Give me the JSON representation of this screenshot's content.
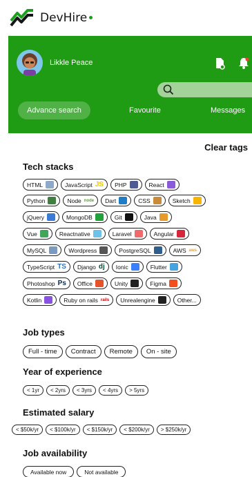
{
  "brand": {
    "name": "DevHire"
  },
  "header": {
    "user_name": "Likkle Peace",
    "tabs": [
      "Advance search",
      "Favourite",
      "Messages"
    ]
  },
  "clear_tags": "Clear tags",
  "tech": {
    "title": "Tech stacks",
    "rows": [
      [
        {
          "label": "HTML",
          "icon": "html-file-icon",
          "color": "#8fa9c8"
        },
        {
          "label": "JavaScript",
          "icon": "js-logo-icon",
          "color": "#f5c400",
          "glyph": "JS"
        },
        {
          "label": "PHP",
          "icon": "php-logo-icon",
          "color": "#4e5b93"
        },
        {
          "label": "React",
          "icon": "react-logo-icon",
          "color": "#8a5bd8"
        }
      ],
      [
        {
          "label": "Python",
          "icon": "python-logo-icon",
          "color": "#3f7f3f"
        },
        {
          "label": "Node",
          "icon": "node-logo-icon",
          "color": "#5a9e3a",
          "glyph": "node"
        },
        {
          "label": "Dart",
          "icon": "dart-logo-icon",
          "color": "#1f7dc6"
        },
        {
          "label": "CSS",
          "icon": "css-brush-icon",
          "color": "#c98a3a"
        },
        {
          "label": "Sketch",
          "icon": "sketch-logo-icon",
          "color": "#f7b500"
        }
      ],
      [
        {
          "label": "jQuery",
          "icon": "jquery-logo-icon",
          "color": "#3a7bd5"
        },
        {
          "label": "MongoDB",
          "icon": "mongodb-leaf-icon",
          "color": "#21a33a"
        },
        {
          "label": "Git",
          "icon": "github-logo-icon",
          "color": "#111111"
        },
        {
          "label": "Java",
          "icon": "java-cup-icon",
          "color": "#e69a2a"
        }
      ],
      [
        {
          "label": "Vue",
          "icon": "vue-logo-icon",
          "color": "#3fa65a"
        },
        {
          "label": "Reactnative",
          "icon": "react-native-logo-icon",
          "color": "#6cc2e8"
        },
        {
          "label": "Laravel",
          "icon": "laravel-logo-icon",
          "color": "#f06b6b"
        },
        {
          "label": "Angular",
          "icon": "angular-logo-icon",
          "color": "#d6283a"
        }
      ],
      [
        {
          "label": "MySQL",
          "icon": "mysql-logo-icon",
          "color": "#7a9bbf"
        },
        {
          "label": "Wordpress",
          "icon": "wordpress-logo-icon",
          "color": "#555555"
        },
        {
          "label": "PostgreSQL",
          "icon": "postgresql-logo-icon",
          "color": "#2f5f8f"
        },
        {
          "label": "AWS",
          "icon": "aws-logo-icon",
          "color": "#f0a030",
          "glyph": "aws"
        }
      ],
      [
        {
          "label": "TypeScript",
          "icon": "typescript-logo-icon",
          "color": "#2f74c0",
          "glyph": "TS"
        },
        {
          "label": "Django",
          "icon": "django-logo-icon",
          "color": "#0c4b33",
          "glyph": "dj"
        },
        {
          "label": "Ionic",
          "icon": "ionic-logo-icon",
          "color": "#3880ff"
        },
        {
          "label": "Flutter",
          "icon": "flutter-logo-icon",
          "color": "#45a3e0"
        }
      ],
      [
        {
          "label": "Photoshop",
          "icon": "photoshop-logo-icon",
          "color": "#0b2a4a",
          "glyph": "Ps"
        },
        {
          "label": "Office",
          "icon": "office-logo-icon",
          "color": "#e5532a"
        },
        {
          "label": "Unity",
          "icon": "unity-logo-icon",
          "color": "#222222"
        },
        {
          "label": "Figma",
          "icon": "figma-logo-icon",
          "color": "#f24e1e"
        }
      ],
      [
        {
          "label": "Kotlin",
          "icon": "kotlin-logo-icon",
          "color": "#8a52e0"
        },
        {
          "label": "Ruby on rails",
          "icon": "rails-logo-icon",
          "color": "#cc0000",
          "glyph": "rails"
        },
        {
          "label": "Unrealengine",
          "icon": "unreal-engine-logo-icon",
          "color": "#222222"
        },
        {
          "label": "Other...",
          "icon": "",
          "color": ""
        }
      ]
    ]
  },
  "job_types": {
    "title": "Job types",
    "options": [
      "Full - time",
      "Contract",
      "Remote",
      "On - site"
    ]
  },
  "experience": {
    "title": "Year of experience",
    "options": [
      "< 1yr",
      "< 2yrs",
      "< 3yrs",
      "< 4yrs",
      "> 5yrs"
    ]
  },
  "salary": {
    "title": "Estimated salary",
    "options": [
      "< $50k/yr",
      "< $100k/yr",
      "< $150k/yr",
      "< $200k/yr",
      "> $250k/yr"
    ]
  },
  "availability": {
    "title": "Job availability",
    "options": [
      "Available now",
      "Not available"
    ]
  },
  "colors": {
    "brand_green": "#1f9b14",
    "search_bg": "#a4d39a"
  }
}
